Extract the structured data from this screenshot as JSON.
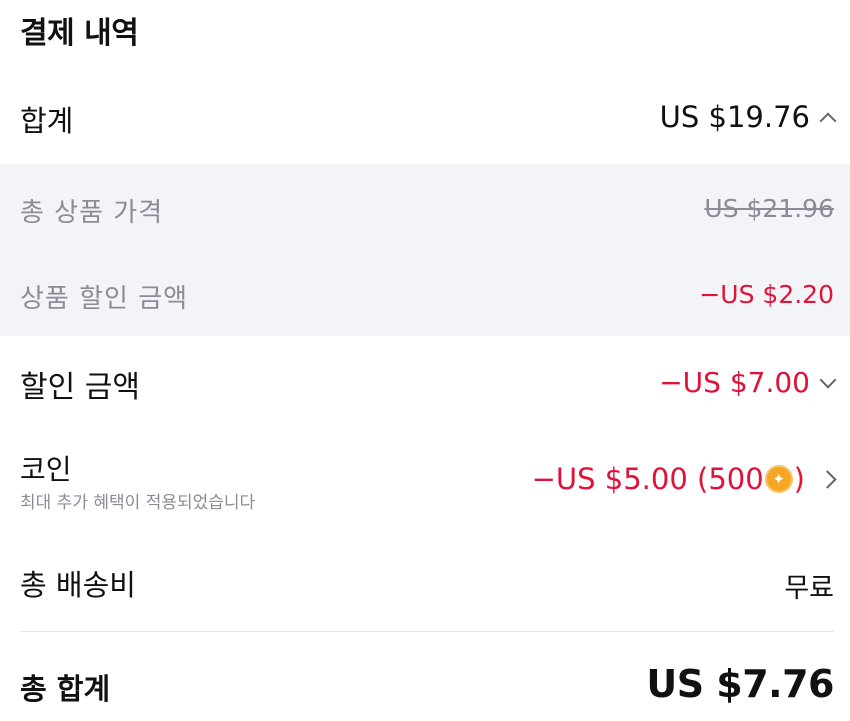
{
  "header": {
    "title": "결제 내역"
  },
  "subtotal": {
    "label": "합계",
    "value": "US $19.76"
  },
  "breakdown": {
    "items": [
      {
        "label": "총 상품 가격",
        "value": "US $21.96",
        "style": "strikethrough"
      },
      {
        "label": "상품 할인 금액",
        "value": "−US $2.20",
        "style": "negative"
      }
    ]
  },
  "discount": {
    "label": "할인 금액",
    "value": "−US $7.00"
  },
  "coins": {
    "label": "코인",
    "note": "최대 추가 혜택이 적용되었습니다",
    "value_prefix": "−US $5.00 (500",
    "value_suffix": ")"
  },
  "shipping": {
    "label": "총 배송비",
    "value": "무료"
  },
  "total": {
    "label": "총 합계",
    "value": "US $7.76"
  },
  "colors": {
    "negative": "#e0123a",
    "muted": "#8a8d96",
    "panel_bg": "#f3f4f8",
    "coin": "#f5a623"
  },
  "icons": [
    "chevron-up-icon",
    "chevron-down-icon",
    "coin-icon",
    "chevron-right-icon"
  ]
}
